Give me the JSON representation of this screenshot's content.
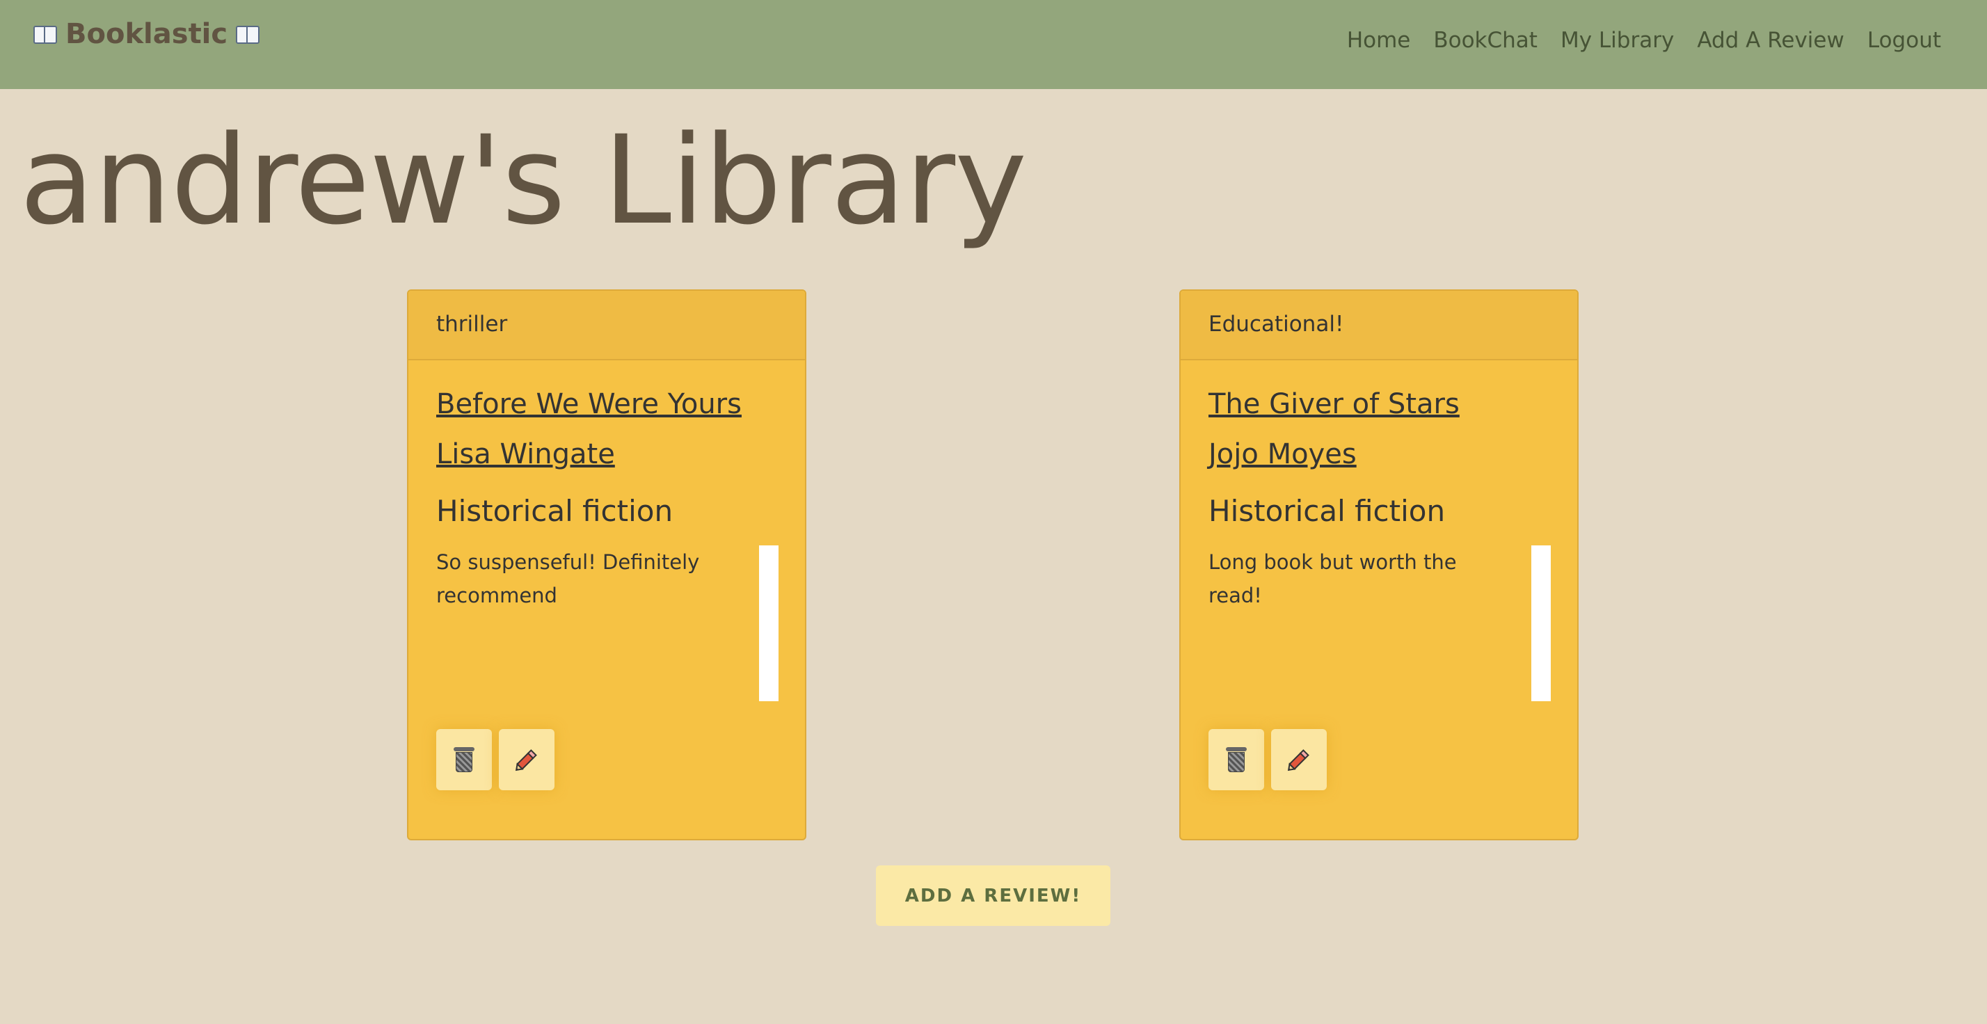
{
  "nav": {
    "brand": "Booklastic",
    "links": [
      "Home",
      "BookChat",
      "My Library",
      "Add A Review",
      "Logout"
    ],
    "colors": {
      "bar": "#93a67c",
      "link": "#465335"
    }
  },
  "page": {
    "title": "andrew's Library",
    "background": "#e4d9c5"
  },
  "cards": [
    {
      "header": "thriller",
      "title": "Before We Were Yours",
      "author": "Lisa Wingate",
      "genre": "Historical fiction",
      "review": "So suspenseful! Definitely recommend",
      "delete_icon": "trash-icon",
      "edit_icon": "pencil-icon"
    },
    {
      "header": "Educational!",
      "title": "The Giver of Stars",
      "author": "Jojo Moyes",
      "genre": "Historical fiction",
      "review": "Long book but worth the read!",
      "delete_icon": "trash-icon",
      "edit_icon": "pencil-icon"
    }
  ],
  "add_review_button": "ADD A REVIEW!",
  "card_color": "#f6c244"
}
